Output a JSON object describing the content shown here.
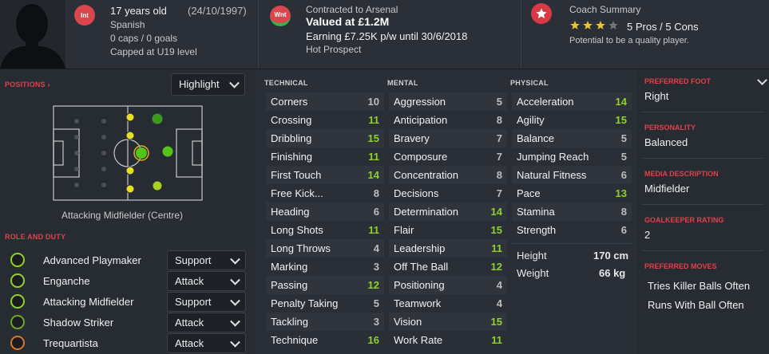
{
  "header": {
    "age": "17 years old",
    "dob": "(24/10/1997)",
    "nationality": "Spanish",
    "caps": "0 caps / 0 goals",
    "capped": "Capped at U19 level",
    "int_badge": "Int",
    "contract_badge": "Wnt",
    "contracted": "Contracted to Arsenal",
    "value": "Valued at £1.2M",
    "earning": "Earning £7.25K p/w until 30/6/2018",
    "status": "Hot Prospect",
    "coach_title": "Coach Summary",
    "pros_cons": "5 Pros / 5 Cons",
    "potential": "Potential to be a quality player.",
    "stars_filled": 3,
    "stars_total": 4
  },
  "positions": {
    "label": "POSITIONS",
    "dropdown": "Highlight",
    "pitch_caption": "Attacking Midfielder (Centre)"
  },
  "roles": {
    "label": "ROLE AND DUTY",
    "items": [
      {
        "name": "Advanced Playmaker",
        "duty": "Support",
        "icon_color": "#8fd12a"
      },
      {
        "name": "Enganche",
        "duty": "Attack",
        "icon_color": "#8fd12a"
      },
      {
        "name": "Attacking Midfielder",
        "duty": "Support",
        "icon_color": "#8fd12a"
      },
      {
        "name": "Shadow Striker",
        "duty": "Attack",
        "icon_color": "#6aa82c"
      },
      {
        "name": "Trequartista",
        "duty": "Attack",
        "icon_color": "#d9762a"
      }
    ]
  },
  "technical": {
    "title": "TECHNICAL",
    "items": [
      {
        "name": "Corners",
        "value": "10"
      },
      {
        "name": "Crossing",
        "value": "11"
      },
      {
        "name": "Dribbling",
        "value": "15"
      },
      {
        "name": "Finishing",
        "value": "11"
      },
      {
        "name": "First Touch",
        "value": "14"
      },
      {
        "name": "Free Kick...",
        "value": "8"
      },
      {
        "name": "Heading",
        "value": "6"
      },
      {
        "name": "Long Shots",
        "value": "11"
      },
      {
        "name": "Long Throws",
        "value": "4"
      },
      {
        "name": "Marking",
        "value": "3"
      },
      {
        "name": "Passing",
        "value": "12"
      },
      {
        "name": "Penalty Taking",
        "value": "5"
      },
      {
        "name": "Tackling",
        "value": "3"
      },
      {
        "name": "Technique",
        "value": "16"
      }
    ]
  },
  "mental": {
    "title": "MENTAL",
    "items": [
      {
        "name": "Aggression",
        "value": "5"
      },
      {
        "name": "Anticipation",
        "value": "8"
      },
      {
        "name": "Bravery",
        "value": "7"
      },
      {
        "name": "Composure",
        "value": "7"
      },
      {
        "name": "Concentration",
        "value": "8"
      },
      {
        "name": "Decisions",
        "value": "7"
      },
      {
        "name": "Determination",
        "value": "14"
      },
      {
        "name": "Flair",
        "value": "15"
      },
      {
        "name": "Leadership",
        "value": "11"
      },
      {
        "name": "Off The Ball",
        "value": "12"
      },
      {
        "name": "Positioning",
        "value": "4"
      },
      {
        "name": "Teamwork",
        "value": "4"
      },
      {
        "name": "Vision",
        "value": "15"
      },
      {
        "name": "Work Rate",
        "value": "11"
      }
    ]
  },
  "physical": {
    "title": "PHYSICAL",
    "items": [
      {
        "name": "Acceleration",
        "value": "14"
      },
      {
        "name": "Agility",
        "value": "15"
      },
      {
        "name": "Balance",
        "value": "5"
      },
      {
        "name": "Jumping Reach",
        "value": "5"
      },
      {
        "name": "Natural Fitness",
        "value": "6"
      },
      {
        "name": "Pace",
        "value": "13"
      },
      {
        "name": "Stamina",
        "value": "8"
      },
      {
        "name": "Strength",
        "value": "6"
      }
    ],
    "height_label": "Height",
    "height": "170 cm",
    "weight_label": "Weight",
    "weight": "66 kg"
  },
  "info": {
    "foot_label": "PREFERRED FOOT",
    "foot": "Right",
    "personality_label": "PERSONALITY",
    "personality": "Balanced",
    "media_label": "MEDIA DESCRIPTION",
    "media": "Midfielder",
    "gk_label": "GOALKEEPER RATING",
    "gk": "2",
    "moves_label": "PREFERRED MOVES",
    "moves": [
      "Tries Killer Balls Often",
      "Runs With Ball Often"
    ]
  },
  "colors": {
    "bg": "#2a2e36",
    "accent_red": "#e0404a",
    "val_green": "#8fd12a",
    "val_grey": "#bdbdbd"
  }
}
